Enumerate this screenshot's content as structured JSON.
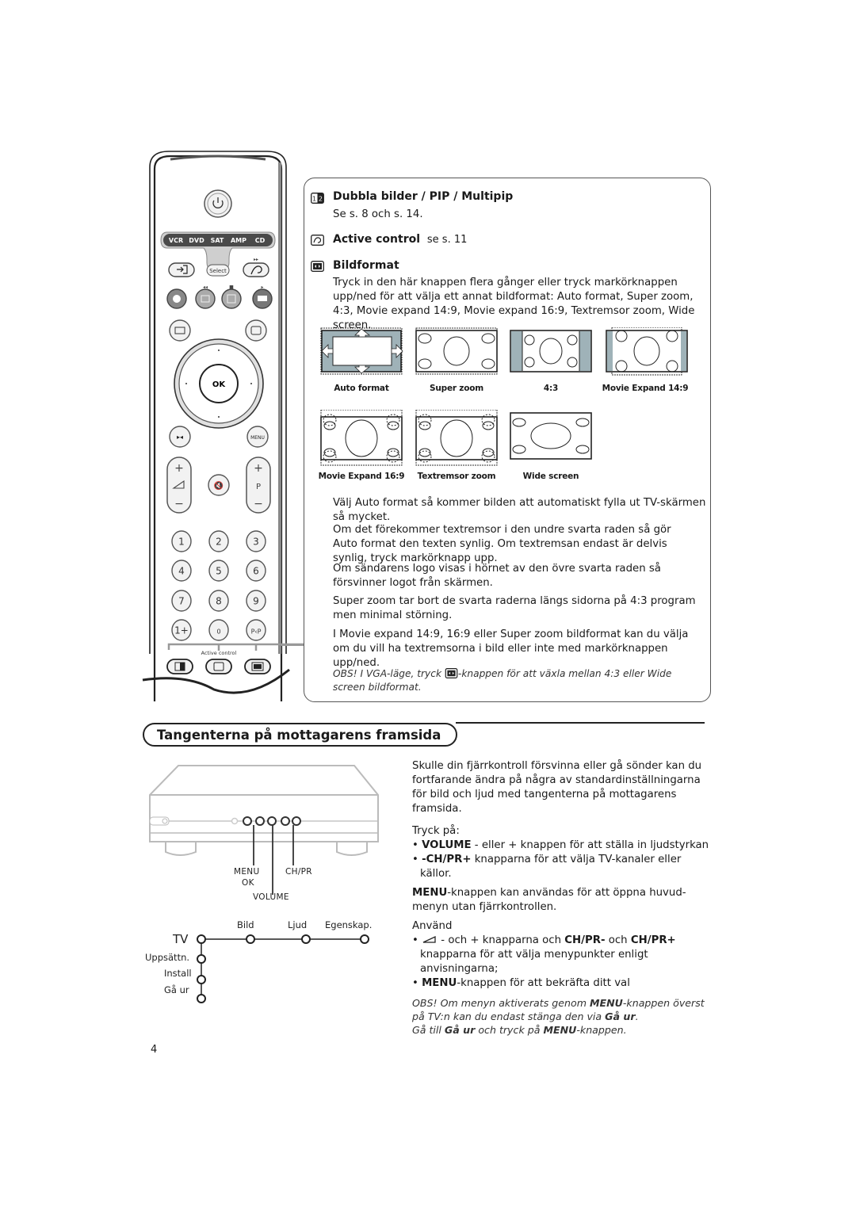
{
  "page_number": "4",
  "remote": {
    "source_buttons": [
      "VCR",
      "DVD",
      "SAT",
      "AMP",
      "CD"
    ],
    "select_label": "Select",
    "ok_label": "OK",
    "menu_label": "MENU",
    "p_label": "P",
    "digits": [
      "1",
      "2",
      "3",
      "4",
      "5",
      "6",
      "7",
      "8",
      "9",
      "0"
    ],
    "pp_label": "P‹P",
    "active_control_label": "Active control",
    "plus": "+",
    "minus": "−"
  },
  "info_panel": {
    "dual": {
      "icon": "dual-screen-icon",
      "title": "Dubbla bilder / PIP / Multipip",
      "ref": "Se s. 8 och s. 14."
    },
    "active": {
      "icon": "active-control-icon",
      "title": "Active control",
      "ref": "se s. 11"
    },
    "format": {
      "icon": "picture-format-icon",
      "title": "Bildformat",
      "description": "Tryck in den här knappen flera gånger eller tryck markörknappen upp/ned för att välja ett annat bildformat: Auto format, Super zoom, 4:3, Movie expand 14:9, Movie expand 16:9, Textremsor zoom, Wide screen."
    },
    "formats": [
      "Auto format",
      "Super zoom",
      "4:3",
      "Movie Expand 14:9",
      "Movie Expand 16:9",
      "Textremsor zoom",
      "Wide screen"
    ],
    "paragraphs": [
      "Välj Auto format så kommer bilden att automatiskt fylla ut TV-skärmen så mycket.",
      "Om det förekommer textremsor i den undre svarta raden så gör Auto format den texten synlig. Om textremsan endast är delvis synlig, tryck markörknapp upp.",
      "Om sändarens logo visas i hörnet av den övre svarta raden så försvinner logot från skärmen.",
      "Super zoom tar bort de svarta raderna längs sidorna på 4:3 program men minimal störning.",
      "I Movie expand 14:9, 16:9 eller Super zoom bildformat kan du välja om du vill ha textremsorna i bild eller inte med markörknappen upp/ned."
    ],
    "note_prefix": "OBS! I VGA-läge, tryck",
    "note_suffix": "-knappen för att växla mellan 4:3 eller Wide screen bildformat."
  },
  "front_section": {
    "title": "Tangenterna på mottagarens framsida",
    "device_labels": {
      "menu": "MENU",
      "ok": "OK",
      "volume": "VOLUME",
      "chpr": "CH/PR"
    },
    "menu_tree": {
      "root": "TV",
      "horizontal": [
        "Bild",
        "Ljud",
        "Egenskap."
      ],
      "vertical": [
        "Uppsättn.",
        "Install",
        "Gå ur"
      ]
    },
    "intro": "Skulle din fjärrkontroll försvinna eller gå sönder kan du fortfarande ändra på några av standardinställningarna för bild och ljud med tangenterna på mottagarens framsida.",
    "press_label": "Tryck på:",
    "press_items": [
      {
        "bold": "VOLUME",
        "text": " - eller + knappen för att ställa in ljudstyrkan"
      },
      {
        "bold": "-CH/PR+",
        "text": " knapparna för att välja TV-kanaler eller källor."
      }
    ],
    "menu_para_bold": "MENU",
    "menu_para_text": "-knappen kan användas för att öppna huvud-menyn utan fjärrkontrollen.",
    "use_label": "Använd",
    "use_item1": {
      "pre": " - och + knapparna och ",
      "b1": "CH/PR-",
      "mid": " och ",
      "b2": "CH/PR+",
      "post": " knapparna för att välja menypunkter enligt anvisningarna;"
    },
    "use_item2": {
      "bold": "MENU",
      "text": "-knappen för att bekräfta ditt val"
    },
    "note": {
      "p1": "OBS!  Om menyn aktiverats genom ",
      "b1": "MENU",
      "p2": "-knappen överst på TV:n kan du endast stänga den via ",
      "b2": "Gå ur",
      "p3": ".",
      "p4": "Gå till ",
      "b3": "Gå ur",
      "p5": " och tryck på ",
      "b4": "MENU",
      "p6": "-knappen."
    }
  }
}
